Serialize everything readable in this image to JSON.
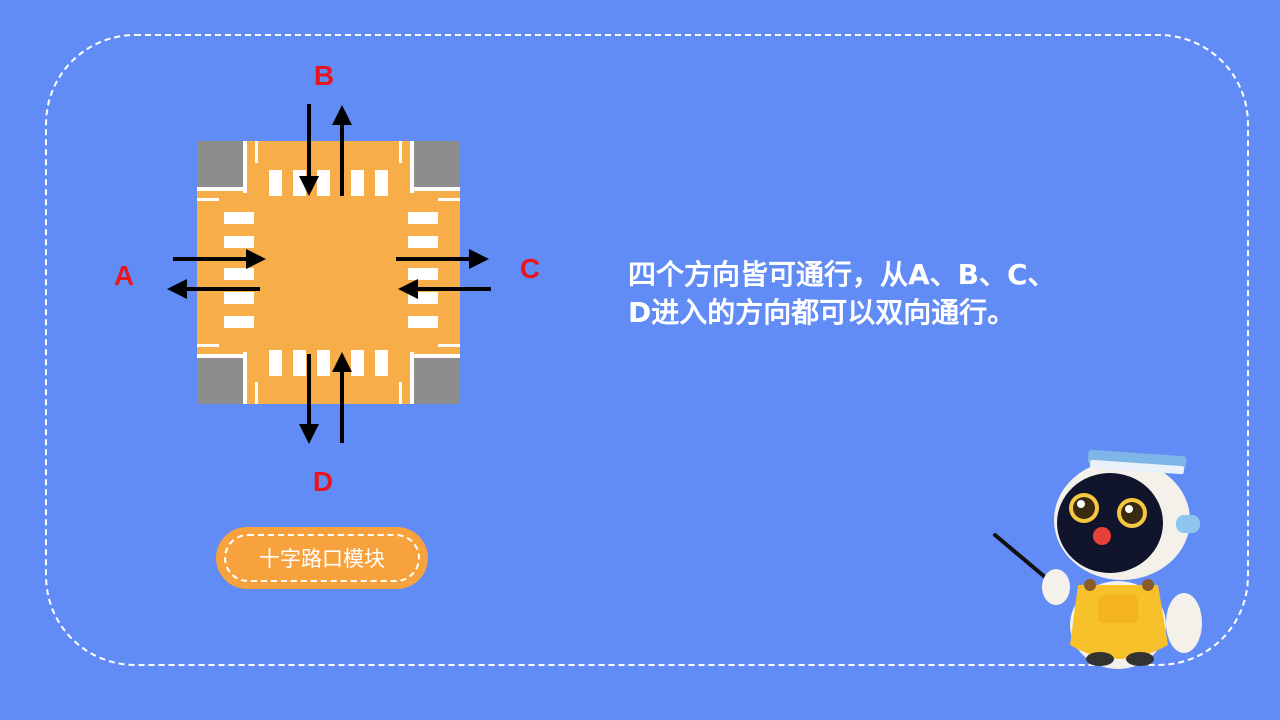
{
  "labels": {
    "a": "A",
    "b": "B",
    "c": "C",
    "d": "D"
  },
  "description": {
    "line1": "四个方向皆可通行，从A、B、C、",
    "line2": "D进入的方向都可以双向通行。"
  },
  "module_button": "十字路口模块",
  "colors": {
    "background": "#628cf5",
    "road": "#f7ad48",
    "corner": "#8d8d8d",
    "label": "#e8141e",
    "button": "#f7a23d"
  },
  "icons": [
    "intersection-icon",
    "arrow-icon",
    "robot-mascot-icon"
  ]
}
